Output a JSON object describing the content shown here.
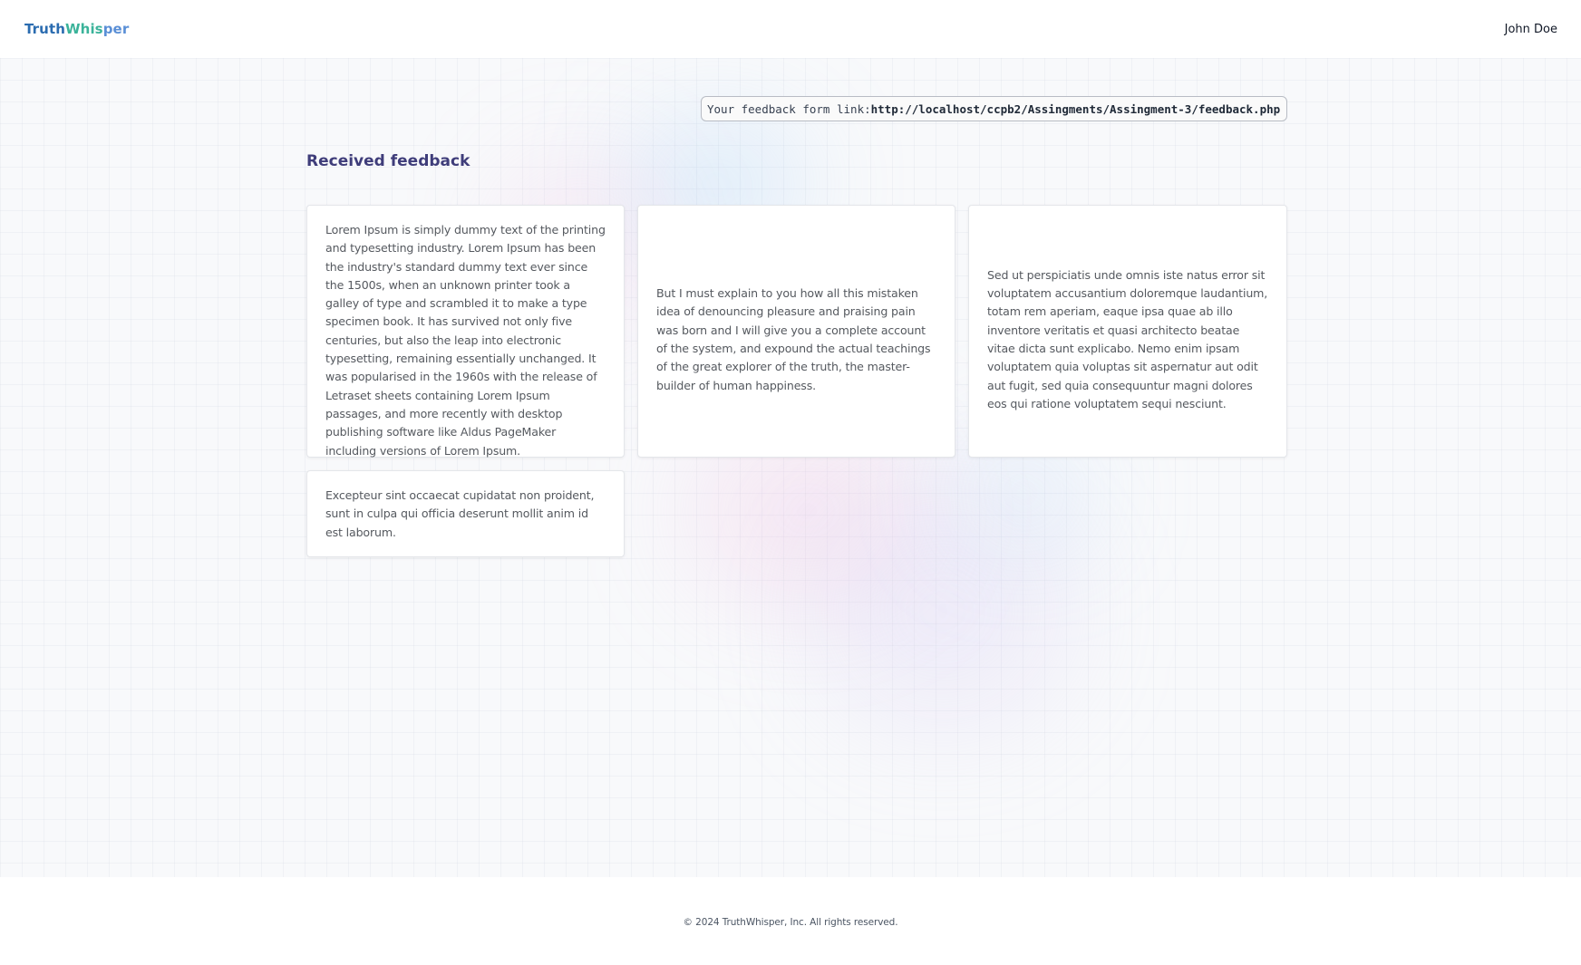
{
  "navbar": {
    "logo": {
      "part1": "Truth",
      "part2": "Whis",
      "part3": "per"
    },
    "user_name": "John Doe"
  },
  "feedback_link": {
    "label": "Your feedback form link: ",
    "url": "http://localhost/ccpb2/Assingments/Assingment-3/feedback.php"
  },
  "section_title": "Received feedback",
  "feedback_items": [
    {
      "text": "Lorem Ipsum is simply dummy text of the printing and typesetting industry. Lorem Ipsum has been the industry's standard dummy text ever since the 1500s, when an unknown printer took a galley of type and scrambled it to make a type specimen book. It has survived not only five centuries, but also the leap into electronic typesetting, remaining essentially unchanged. It was popularised in the 1960s with the release of Letraset sheets containing Lorem Ipsum passages, and more recently with desktop publishing software like Aldus PageMaker including versions of Lorem Ipsum."
    },
    {
      "text": "But I must explain to you how all this mistaken idea of denouncing pleasure and praising pain was born and I will give you a complete account of the system, and expound the actual teachings of the great explorer of the truth, the master-builder of human happiness."
    },
    {
      "text": "Sed ut perspiciatis unde omnis iste natus error sit voluptatem accusantium doloremque laudantium, totam rem aperiam, eaque ipsa quae ab illo inventore veritatis et quasi architecto beatae vitae dicta sunt explicabo. Nemo enim ipsam voluptatem quia voluptas sit aspernatur aut odit aut fugit, sed quia consequuntur magni dolores eos qui ratione voluptatem sequi nesciunt."
    },
    {
      "text": "Excepteur sint occaecat cupidatat non proident, sunt in culpa qui officia deserunt mollit anim id est laborum."
    }
  ],
  "footer": {
    "copyright": "© 2024 TruthWhisper, Inc. All rights reserved."
  }
}
